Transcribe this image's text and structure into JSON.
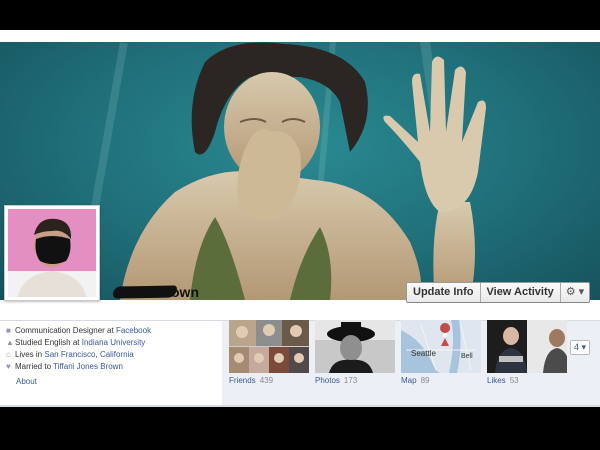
{
  "profile": {
    "name_visible_fragment": "own",
    "cover_alt": "underwater photo of woman holding nose",
    "picture_alt": "man with blacked-out face"
  },
  "actions": {
    "update_info": "Update Info",
    "view_activity": "View Activity",
    "gear_caret": "⚙ ▾"
  },
  "about": {
    "lines": [
      {
        "icon": "briefcase-icon",
        "glyph": "■",
        "prefix": "Communication Designer at ",
        "link": "Facebook",
        "middle": "",
        "link2": ""
      },
      {
        "icon": "graduation-icon",
        "glyph": "▲",
        "prefix": "Studied English at ",
        "link": "Indiana University",
        "middle": "",
        "link2": ""
      },
      {
        "icon": "home-icon",
        "glyph": "⌂",
        "prefix": "Lives in ",
        "link": "San Francisco",
        "middle": ", ",
        "link2": "California"
      },
      {
        "icon": "heart-icon",
        "glyph": "♥",
        "prefix": "Married to ",
        "link": "Tiffani Jones Brown",
        "middle": "",
        "link2": ""
      }
    ],
    "about_link": "About"
  },
  "apps": [
    {
      "label": "Friends",
      "count": "439"
    },
    {
      "label": "Photos",
      "count": "173"
    },
    {
      "label": "Map",
      "count": "89"
    },
    {
      "label": "Likes",
      "count": "53"
    }
  ],
  "more_apps": "4 ▾",
  "colors": {
    "link": "#3b5998",
    "water": "#1f6e78",
    "apps_bg": "#eceff5"
  }
}
